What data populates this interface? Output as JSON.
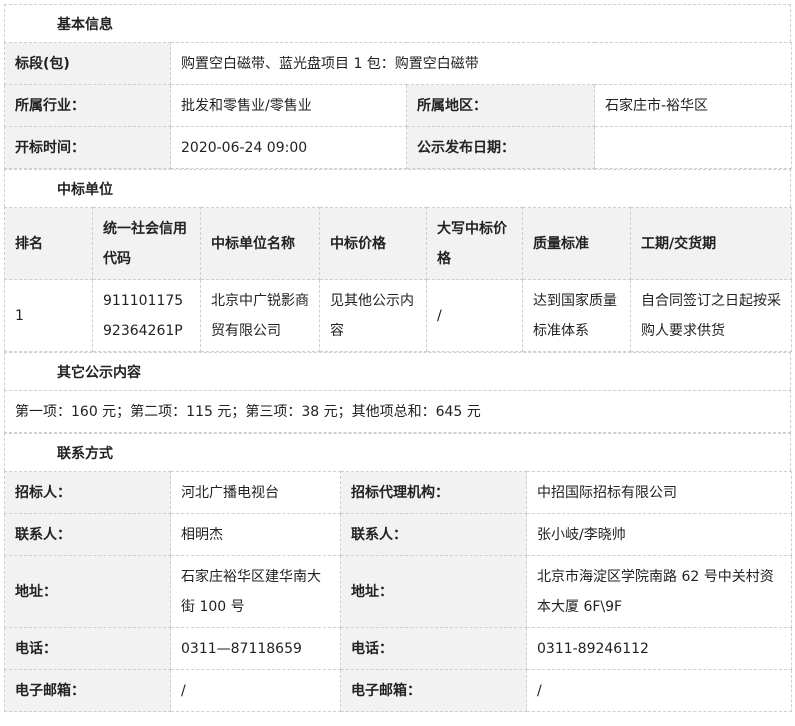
{
  "sections": {
    "basic": "基本信息",
    "winner": "中标单位",
    "other": "其它公示内容",
    "contact": "联系方式"
  },
  "basic": {
    "lot_label": "标段(包)",
    "lot_value": "购置空白磁带、蓝光盘项目 1 包：购置空白磁带",
    "industry_label": "所属行业：",
    "industry_value": "批发和零售业/零售业",
    "region_label": "所属地区：",
    "region_value": "石家庄市-裕华区",
    "open_time_label": "开标时间：",
    "open_time_value": "2020-06-24 09:00",
    "publish_date_label": "公示发布日期：",
    "publish_date_value": ""
  },
  "winner": {
    "headers": [
      "排名",
      "统一社会信用代码",
      "中标单位名称",
      "中标价格",
      "大写中标价格",
      "质量标准",
      "工期/交货期"
    ],
    "row": {
      "rank": "1",
      "credit_code": "91110117592364261P",
      "name": "北京中广锐影商贸有限公司",
      "price": "见其他公示内容",
      "price_upper": "/",
      "quality": "达到国家质量标准体系",
      "delivery": "自合同签订之日起按采购人要求供货"
    }
  },
  "other": {
    "text": "第一项：160 元；第二项：115 元；第三项：38 元；其他项总和：645 元"
  },
  "contact": {
    "tenderer_label": "招标人：",
    "tenderer_value": "河北广播电视台",
    "agency_label": "招标代理机构：",
    "agency_value": "中招国际招标有限公司",
    "contact1_label": "联系人：",
    "contact1_value": "相明杰",
    "contact2_label": "联系人：",
    "contact2_value": "张小岐/李晓帅",
    "addr1_label": "地址：",
    "addr1_value": "石家庄裕华区建华南大街 100 号",
    "addr2_label": "地址：",
    "addr2_value": "北京市海淀区学院南路 62 号中关村资本大厦 6F\\9F",
    "phone1_label": "电话：",
    "phone1_value": "0311—87118659",
    "phone2_label": "电话：",
    "phone2_value": "0311-89246112",
    "email1_label": "电子邮箱：",
    "email1_value": "/",
    "email2_label": "电子邮箱：",
    "email2_value": "/"
  }
}
